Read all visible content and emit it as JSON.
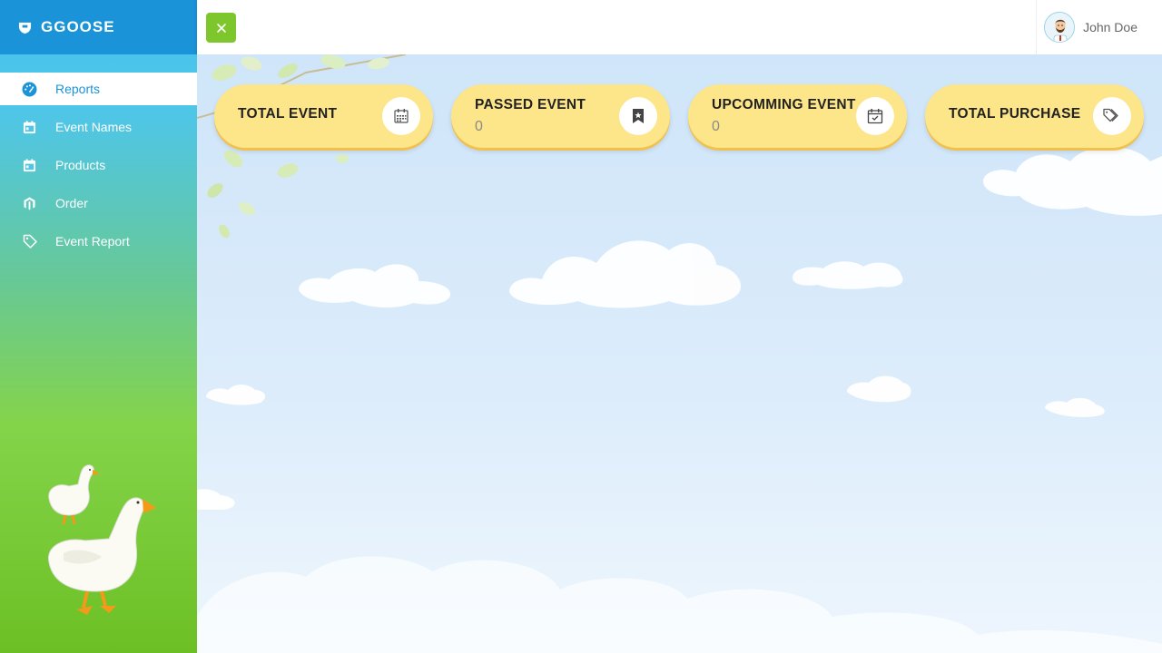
{
  "brand": {
    "name": "GGOOSE",
    "icon": "brand-shield-icon"
  },
  "sidebar": {
    "items": [
      {
        "label": "Reports",
        "icon": "dashboard-gauge-icon",
        "active": true
      },
      {
        "label": "Event Names",
        "icon": "calendar-icon",
        "active": false
      },
      {
        "label": "Products",
        "icon": "calendar-icon",
        "active": false
      },
      {
        "label": "Order",
        "icon": "magento-icon",
        "active": false
      },
      {
        "label": "Event Report",
        "icon": "tag-icon",
        "active": false
      }
    ]
  },
  "header": {
    "toggle_icon": "close-icon",
    "user": {
      "name": "John Doe",
      "avatar": "avatar-icon"
    }
  },
  "cards": [
    {
      "title": "TOTAL EVENT",
      "value": "",
      "icon": "calendar-grid-icon"
    },
    {
      "title": "PASSED EVENT",
      "value": "0",
      "icon": "bookmark-star-icon"
    },
    {
      "title": "UPCOMMING EVENT",
      "value": "0",
      "icon": "calendar-check-icon"
    },
    {
      "title": "TOTAL PURCHASE",
      "value": "",
      "icon": "tags-icon"
    }
  ],
  "colors": {
    "brand_bar": "#1a93d8",
    "active_text": "#1a93d8",
    "toggle_button": "#7dc72d",
    "card_bg": "#fde58a",
    "card_shadow": "#f0c14e"
  }
}
